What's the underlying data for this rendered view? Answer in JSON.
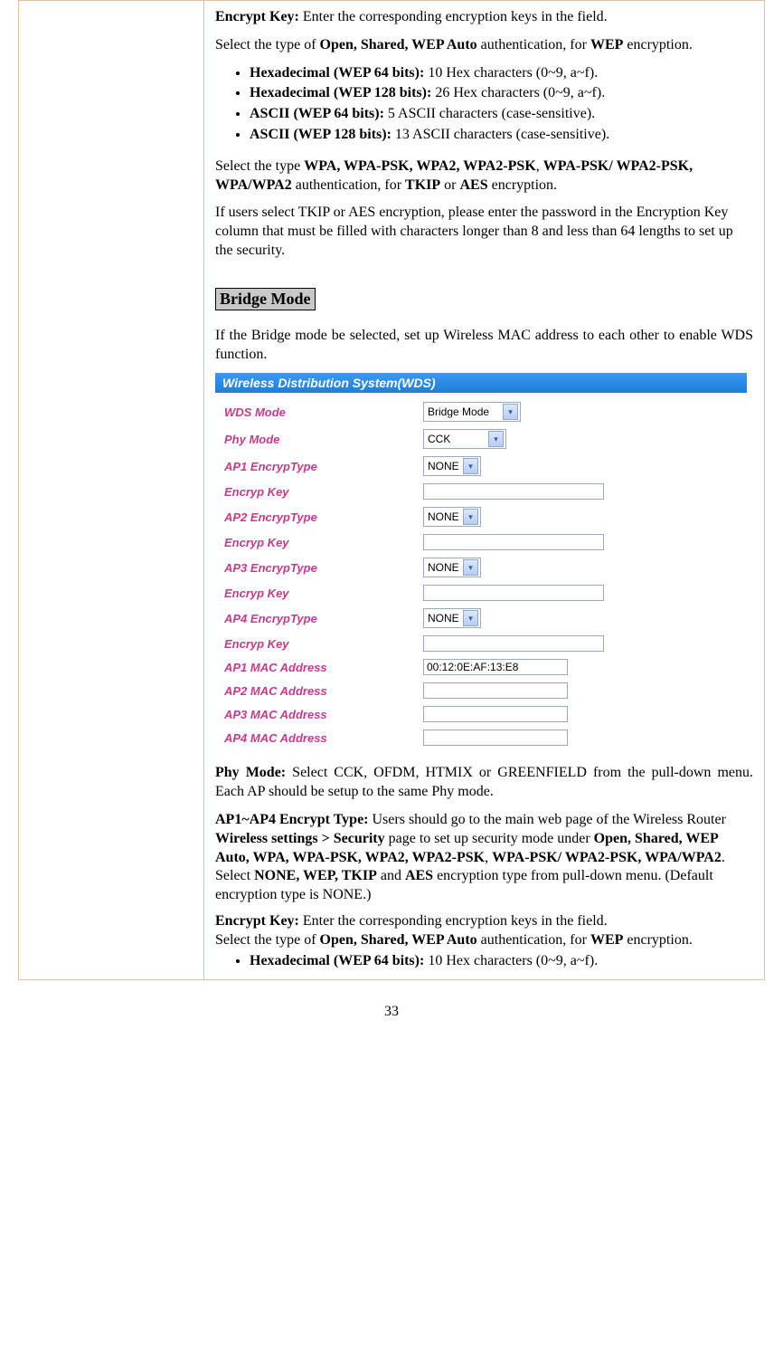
{
  "sec1": {
    "encrypt_key_label": "Encrypt Key:",
    "encrypt_key_text": " Enter the corresponding encryption keys in the field.",
    "p2_a": "Select the type of ",
    "p2_b": "Open, Shared, WEP Auto",
    "p2_c": " authentication, for ",
    "p2_d": "WEP",
    "p2_e": " encryption.",
    "li1_b": "Hexadecimal (WEP 64 bits):",
    "li1_t": " 10 Hex characters (0~9, a~f).",
    "li2_b": "Hexadecimal (WEP 128 bits):",
    "li2_t": " 26 Hex characters (0~9, a~f).",
    "li3_b": "ASCII (WEP 64 bits):",
    "li3_t": " 5 ASCII characters (case-sensitive).",
    "li4_b": "ASCII (WEP 128 bits):",
    "li4_t": " 13 ASCII characters (case-sensitive).",
    "p3_a": "Select the type ",
    "p3_b": "WPA, WPA-PSK, WPA2, WPA2-PSK",
    "p3_c": ", ",
    "p3_d": "WPA-PSK/ WPA2-PSK, WPA/WPA2",
    "p3_e": " authentication, for  ",
    "p3_f": "TKIP",
    "p3_g": " or ",
    "p3_h": "AES",
    "p3_i": " encryption.",
    "p4": "If users select TKIP or AES encryption, please enter the password in the Encryption Key column that must be filled with characters longer than 8 and less than 64 lengths to set up the security."
  },
  "bridge": {
    "title": "Bridge Mode",
    "intro": "If the Bridge mode be selected, set up Wireless MAC address to each other to enable WDS function."
  },
  "wds": {
    "header": "Wireless Distribution System(WDS)",
    "rows": [
      {
        "label": "WDS Mode",
        "type": "select",
        "value": "Bridge Mode",
        "w": "wide"
      },
      {
        "label": "Phy Mode",
        "type": "select",
        "value": "CCK",
        "w": "med"
      },
      {
        "label": "AP1 EncrypType",
        "type": "select",
        "value": "NONE",
        "w": "sm"
      },
      {
        "label": "Encryp Key",
        "type": "text",
        "value": "",
        "w": "long"
      },
      {
        "label": "AP2 EncrypType",
        "type": "select",
        "value": "NONE",
        "w": "sm"
      },
      {
        "label": "Encryp Key",
        "type": "text",
        "value": "",
        "w": "long"
      },
      {
        "label": "AP3 EncrypType",
        "type": "select",
        "value": "NONE",
        "w": "sm"
      },
      {
        "label": "Encryp Key",
        "type": "text",
        "value": "",
        "w": "long"
      },
      {
        "label": "AP4 EncrypType",
        "type": "select",
        "value": "NONE",
        "w": "sm"
      },
      {
        "label": "Encryp Key",
        "type": "text",
        "value": "",
        "w": "long"
      },
      {
        "label": "AP1 MAC Address",
        "type": "text",
        "value": "00:12:0E:AF:13:E8",
        "w": "med"
      },
      {
        "label": "AP2 MAC Address",
        "type": "text",
        "value": "",
        "w": "med"
      },
      {
        "label": "AP3 MAC Address",
        "type": "text",
        "value": "",
        "w": "med"
      },
      {
        "label": "AP4 MAC Address",
        "type": "text",
        "value": "",
        "w": "med"
      }
    ]
  },
  "sec2": {
    "phy_b": "Phy Mode:",
    "phy_t": " Select CCK, OFDM, HTMIX or GREENFIELD from the pull-down menu. Each AP should be setup to the same Phy mode.",
    "ap_b": "AP1~AP4 Encrypt Type:",
    "ap_t1": " Users should go to the main web page of the Wireless  Router ",
    "ap_t2": "Wireless settings > Security",
    "ap_t3": " page to set up security mode under ",
    "ap_t4": "Open, Shared, WEP Auto, WPA, WPA-PSK, WPA2, WPA2-PSK",
    "ap_t5": ", ",
    "ap_t6": "WPA-PSK/ WPA2-PSK, WPA/WPA2",
    "ap_t7": ".",
    "sel_a": "Select ",
    "sel_b": "NONE, WEP, TKIP",
    "sel_c": " and ",
    "sel_d": "AES",
    "sel_e": "  encryption type from pull-down menu. (Default encryption type is NONE.)",
    "ek_b": "Encrypt Key:",
    "ek_t": " Enter the corresponding encryption keys in the field.",
    "ek2_a": "Select the type of ",
    "ek2_b": "Open, Shared, WEP Auto",
    "ek2_c": " authentication, for ",
    "ek2_d": "WEP",
    "ek2_e": " encryption.",
    "li_b": "Hexadecimal (WEP 64 bits):",
    "li_t": " 10 Hex characters (0~9, a~f)."
  },
  "page_num": "33"
}
